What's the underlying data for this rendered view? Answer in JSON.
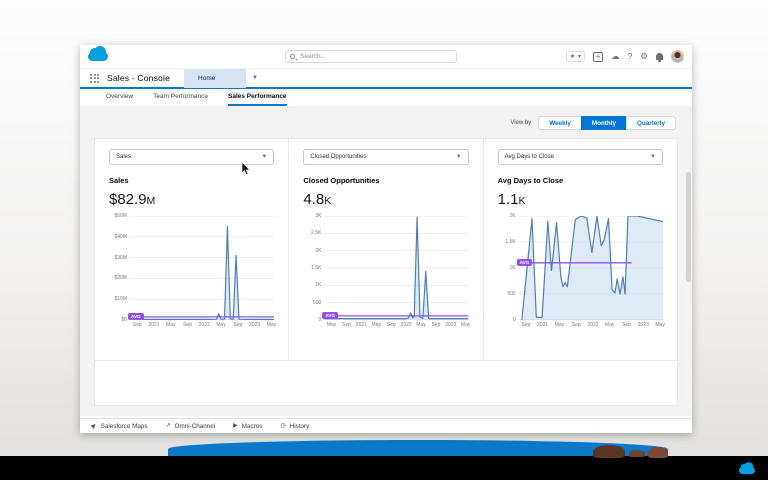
{
  "window": {
    "app_name": "Sales - Console",
    "nav_tab_label": "Home",
    "search_placeholder": "Search...",
    "tabs": [
      {
        "label": "Overview"
      },
      {
        "label": "Team Performance"
      },
      {
        "label": "Sales Performance"
      }
    ],
    "active_tab": "Sales Performance",
    "view_by": {
      "label": "View by",
      "options": [
        "Weekly",
        "Monthly",
        "Quarterly"
      ],
      "selected": "Monthly"
    },
    "utility_bar": [
      {
        "label": "Salesforce Maps"
      },
      {
        "label": "Omni-Channel"
      },
      {
        "label": "Macros"
      },
      {
        "label": "History"
      }
    ]
  },
  "colors": {
    "brand_blue": "#00a1e0",
    "accent_blue": "#0176d3",
    "nav_underline": "#0b77c2",
    "chart_line": "#4a7eb8",
    "chart_fill": "#c6d9ef",
    "avg_purple": "#9050e9"
  },
  "chart_data": [
    {
      "type": "area",
      "selector_label": "Sales",
      "title": "Sales",
      "kpi_value": "$82.9",
      "kpi_suffix": "M",
      "ylim": [
        0,
        50
      ],
      "y_ticks": [
        "$50M",
        "$40M",
        "$30M",
        "$20M",
        "$10M",
        "$0"
      ],
      "x_ticks": [
        "Sep",
        "2021",
        "May",
        "Sep",
        "2022",
        "May",
        "Sep",
        "2023",
        "May"
      ],
      "avg": {
        "label": "AVG",
        "value": 1.5,
        "x_end": 1.0
      },
      "points": [
        [
          0,
          0.3
        ],
        [
          0.1,
          0.3
        ],
        [
          0.2,
          0.3
        ],
        [
          0.3,
          0.3
        ],
        [
          0.4,
          0.3
        ],
        [
          0.5,
          0.3
        ],
        [
          0.57,
          0.3
        ],
        [
          0.6,
          0.4
        ],
        [
          0.615,
          3
        ],
        [
          0.63,
          0.4
        ],
        [
          0.655,
          0.4
        ],
        [
          0.675,
          45
        ],
        [
          0.695,
          0.6
        ],
        [
          0.715,
          0.4
        ],
        [
          0.735,
          31
        ],
        [
          0.755,
          0.4
        ],
        [
          0.8,
          0.3
        ],
        [
          0.9,
          0.3
        ],
        [
          1,
          0.3
        ]
      ]
    },
    {
      "type": "area",
      "selector_label": "Closed Opportunities",
      "title": "Closed Opportunities",
      "kpi_value": "4.8",
      "kpi_suffix": "K",
      "ylim": [
        0,
        3000
      ],
      "y_ticks": [
        "3K",
        "2.5K",
        "2K",
        "1.5K",
        "1K",
        "500",
        "0"
      ],
      "x_ticks": [
        "May",
        "Sep",
        "2021",
        "May",
        "Sep",
        "2022",
        "May",
        "Sep",
        "2023",
        "May"
      ],
      "avg": {
        "label": "AVG",
        "value": 120,
        "x_end": 1.0
      },
      "points": [
        [
          0,
          40
        ],
        [
          0.1,
          40
        ],
        [
          0.2,
          40
        ],
        [
          0.3,
          40
        ],
        [
          0.4,
          40
        ],
        [
          0.5,
          40
        ],
        [
          0.565,
          40
        ],
        [
          0.585,
          60
        ],
        [
          0.6,
          200
        ],
        [
          0.615,
          60
        ],
        [
          0.625,
          100
        ],
        [
          0.645,
          2970
        ],
        [
          0.665,
          80
        ],
        [
          0.685,
          50
        ],
        [
          0.705,
          1400
        ],
        [
          0.725,
          40
        ],
        [
          0.8,
          40
        ],
        [
          0.9,
          40
        ],
        [
          1,
          40
        ]
      ]
    },
    {
      "type": "area",
      "selector_label": "Avg Days to Close",
      "title": "Avg Days to Close",
      "kpi_value": "1.1",
      "kpi_suffix": "K",
      "ylim": [
        0,
        2000
      ],
      "y_ticks": [
        "2K",
        "1.5K",
        "1K",
        "500",
        "0"
      ],
      "x_ticks": [
        "Sep",
        "2021",
        "May",
        "Sep",
        "2022",
        "May",
        "Sep",
        "2023",
        "May"
      ],
      "avg": {
        "label": "AVG",
        "value": 1100,
        "x_end": 0.78
      },
      "points": [
        [
          0.02,
          0
        ],
        [
          0.09,
          1950
        ],
        [
          0.12,
          50
        ],
        [
          0.16,
          50
        ],
        [
          0.2,
          1900
        ],
        [
          0.225,
          950
        ],
        [
          0.26,
          1870
        ],
        [
          0.29,
          830
        ],
        [
          0.305,
          640
        ],
        [
          0.32,
          720
        ],
        [
          0.335,
          640
        ],
        [
          0.39,
          1930
        ],
        [
          0.43,
          2000
        ],
        [
          0.47,
          1960
        ],
        [
          0.505,
          1300
        ],
        [
          0.54,
          1990
        ],
        [
          0.57,
          1430
        ],
        [
          0.59,
          1540
        ],
        [
          0.62,
          1950
        ],
        [
          0.645,
          590
        ],
        [
          0.665,
          520
        ],
        [
          0.68,
          790
        ],
        [
          0.7,
          500
        ],
        [
          0.72,
          830
        ],
        [
          0.735,
          500
        ],
        [
          0.755,
          2000
        ],
        [
          0.82,
          2000
        ],
        [
          1,
          1890
        ]
      ]
    }
  ]
}
